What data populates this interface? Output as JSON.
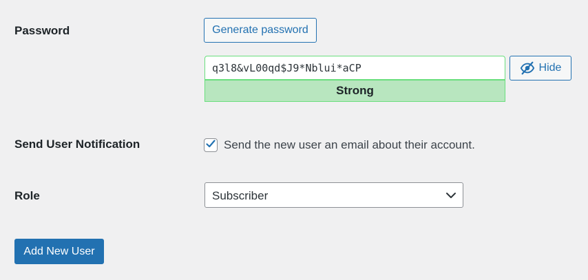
{
  "password": {
    "label": "Password",
    "generate_label": "Generate password",
    "value": "q3l8&vL00qd$J9*Nblui*aCP",
    "strength": "Strong",
    "toggle_label": "Hide",
    "toggle_icon": "eye-slash-icon"
  },
  "notification": {
    "label": "Send User Notification",
    "checkbox_label": "Send the new user an email about their account.",
    "checked": true
  },
  "role": {
    "label": "Role",
    "selected": "Subscriber"
  },
  "submit": {
    "label": "Add New User"
  },
  "colors": {
    "accent": "#2271b1",
    "strength_bg": "#b8e6bf",
    "strength_border": "#68de7c",
    "page_bg": "#f0f0f1"
  }
}
